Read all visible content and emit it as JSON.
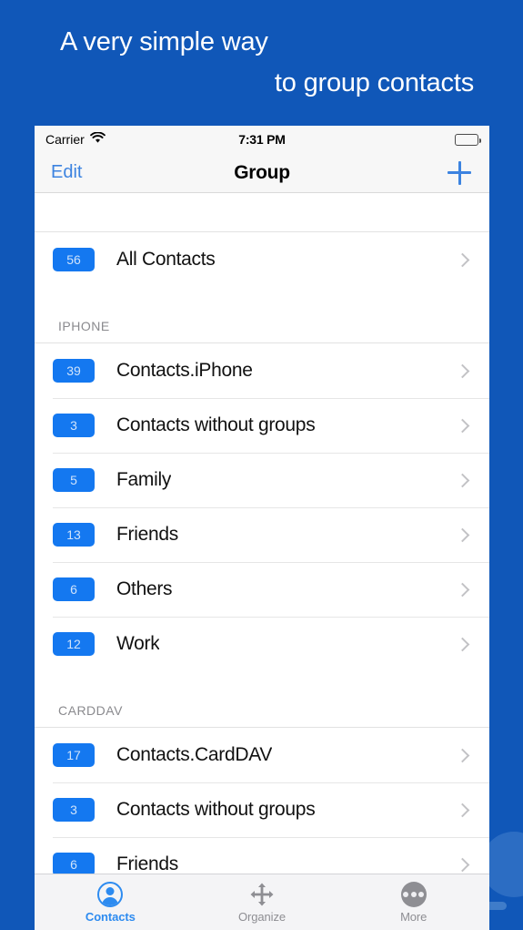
{
  "theme": {
    "background": "#1057B8",
    "accent": "#2D8BF0",
    "badge_bg": "#1478F0",
    "badge_text": "#CFE3FB",
    "nav_tint": "#3C83E0"
  },
  "headline": {
    "line_1": "A very simple way",
    "line_2": "to group contacts"
  },
  "status_bar": {
    "carrier": "Carrier",
    "wifi_icon": "wifi-icon",
    "time": "7:31 PM",
    "battery_icon": "battery-full-icon"
  },
  "nav_bar": {
    "edit_label": "Edit",
    "title": "Group",
    "add_icon": "plus-icon"
  },
  "list": {
    "sections": [
      {
        "header": "",
        "rows": [
          {
            "badge": "56",
            "label": "All Contacts"
          }
        ]
      },
      {
        "header": "IPHONE",
        "rows": [
          {
            "badge": "39",
            "label": "Contacts.iPhone"
          },
          {
            "badge": "3",
            "label": "Contacts without groups"
          },
          {
            "badge": "5",
            "label": "Family"
          },
          {
            "badge": "13",
            "label": "Friends"
          },
          {
            "badge": "6",
            "label": "Others"
          },
          {
            "badge": "12",
            "label": "Work"
          }
        ]
      },
      {
        "header": "CARDDAV",
        "rows": [
          {
            "badge": "17",
            "label": "Contacts.CardDAV"
          },
          {
            "badge": "3",
            "label": "Contacts without groups"
          },
          {
            "badge": "6",
            "label": "Friends"
          }
        ]
      }
    ]
  },
  "tab_bar": {
    "tabs": [
      {
        "label": "Contacts",
        "icon": "person-circle-icon",
        "active": true
      },
      {
        "label": "Organize",
        "icon": "move-arrows-icon",
        "active": false
      },
      {
        "label": "More",
        "icon": "ellipsis-circle-icon",
        "active": false
      }
    ]
  }
}
